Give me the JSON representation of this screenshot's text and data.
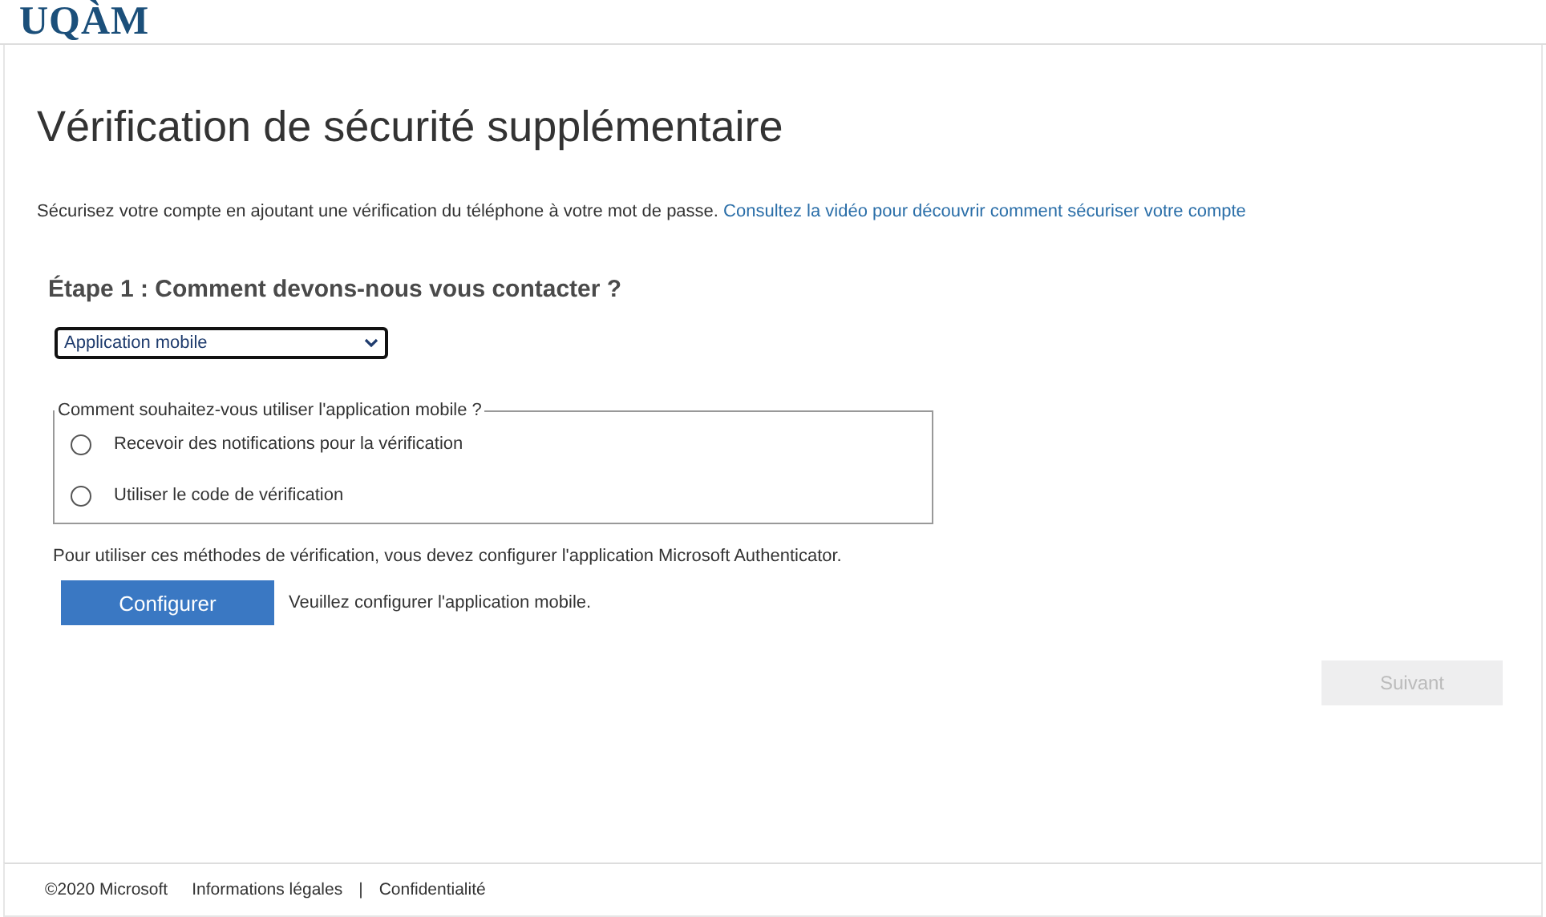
{
  "logo": "UQÀM",
  "title": "Vérification de sécurité supplémentaire",
  "intro": {
    "text": "Sécurisez votre compte en ajoutant une vérification du téléphone à votre mot de passe.",
    "link": "Consultez la vidéo pour découvrir comment sécuriser votre compte"
  },
  "step_heading": "Étape 1 : Comment devons-nous vous contacter ?",
  "contact_method": {
    "value": "Application mobile"
  },
  "mobile_app_options": {
    "legend": "Comment souhaitez-vous utiliser l'application mobile ?",
    "options": [
      {
        "label": "Recevoir des notifications pour la vérification",
        "selected": false
      },
      {
        "label": "Utiliser le code de vérification",
        "selected": false
      }
    ]
  },
  "instruction": "Pour utiliser ces méthodes de vérification, vous devez configurer l'application Microsoft Authenticator.",
  "configure_button": "Configurer",
  "configure_hint": "Veuillez configurer l'application mobile.",
  "next_button": {
    "label": "Suivant",
    "disabled": true
  },
  "footer": [
    {
      "kind": "text",
      "label": "©2020 Microsoft"
    },
    {
      "kind": "link",
      "label": "Informations légales"
    },
    {
      "kind": "separator",
      "label": "|"
    },
    {
      "kind": "link",
      "label": "Confidentialité"
    }
  ]
}
